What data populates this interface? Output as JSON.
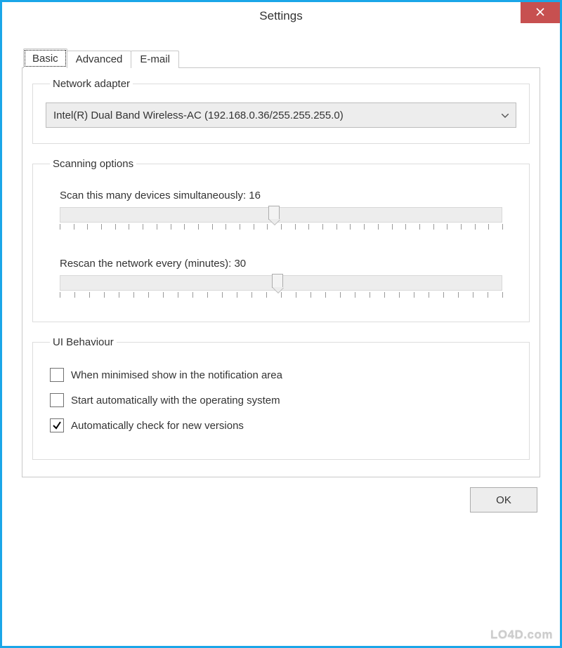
{
  "window": {
    "title": "Settings"
  },
  "tabs": [
    {
      "label": "Basic",
      "active": true
    },
    {
      "label": "Advanced",
      "active": false
    },
    {
      "label": "E-mail",
      "active": false
    }
  ],
  "groups": {
    "network_adapter": {
      "legend": "Network adapter",
      "selected": "Intel(R) Dual Band Wireless-AC (192.168.0.36/255.255.255.0)"
    },
    "scanning": {
      "legend": "Scanning options",
      "scan_count": {
        "label_prefix": "Scan this many devices simultaneously: ",
        "value": 16,
        "min": 1,
        "max": 32,
        "tick_count": 32
      },
      "rescan": {
        "label_prefix": "Rescan the network every (minutes): ",
        "value": 30,
        "min": 1,
        "max": 60,
        "tick_count": 30
      }
    },
    "ui_behaviour": {
      "legend": "UI Behaviour",
      "options": [
        {
          "label": "When minimised show in the notification area",
          "checked": false
        },
        {
          "label": "Start automatically with the operating system",
          "checked": false
        },
        {
          "label": "Automatically check for new versions",
          "checked": true
        }
      ]
    }
  },
  "buttons": {
    "ok": "OK"
  },
  "watermark": "LO4D.com"
}
